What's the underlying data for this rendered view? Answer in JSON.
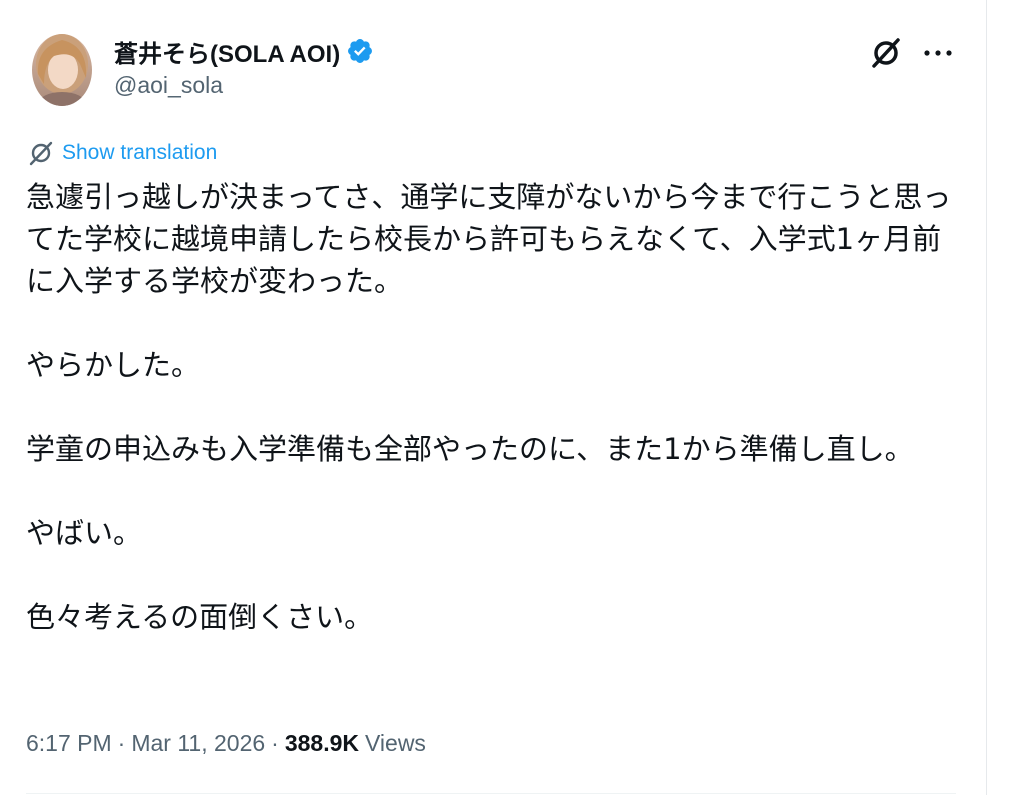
{
  "author": {
    "display_name": "蒼井そら(SOLA AOI)",
    "handle": "@aoi_sola"
  },
  "translate": {
    "label": "Show translation"
  },
  "tweet": {
    "paragraphs": [
      "急遽引っ越しが決まってさ、通学に支障がないから今まで行こうと思ってた学校に越境申請したら校長から許可もらえなくて、入学式1ヶ月前に入学する学校が変わった。",
      "やらかした。",
      "学童の申込みも入学準備も全部やったのに、また1から準備し直し。",
      "やばい。",
      "色々考えるの面倒くさい。"
    ]
  },
  "meta": {
    "time": "6:17 PM",
    "separator": "·",
    "date": "Mar 11, 2026",
    "views_count": "388.9K",
    "views_label": "Views"
  },
  "colors": {
    "text_primary": "#0f1419",
    "text_secondary": "#536471",
    "accent": "#1d9bf0"
  },
  "icons": {
    "verified": "verified-badge-icon",
    "grok": "grok-icon",
    "more": "more-icon",
    "translate": "translate-icon"
  }
}
